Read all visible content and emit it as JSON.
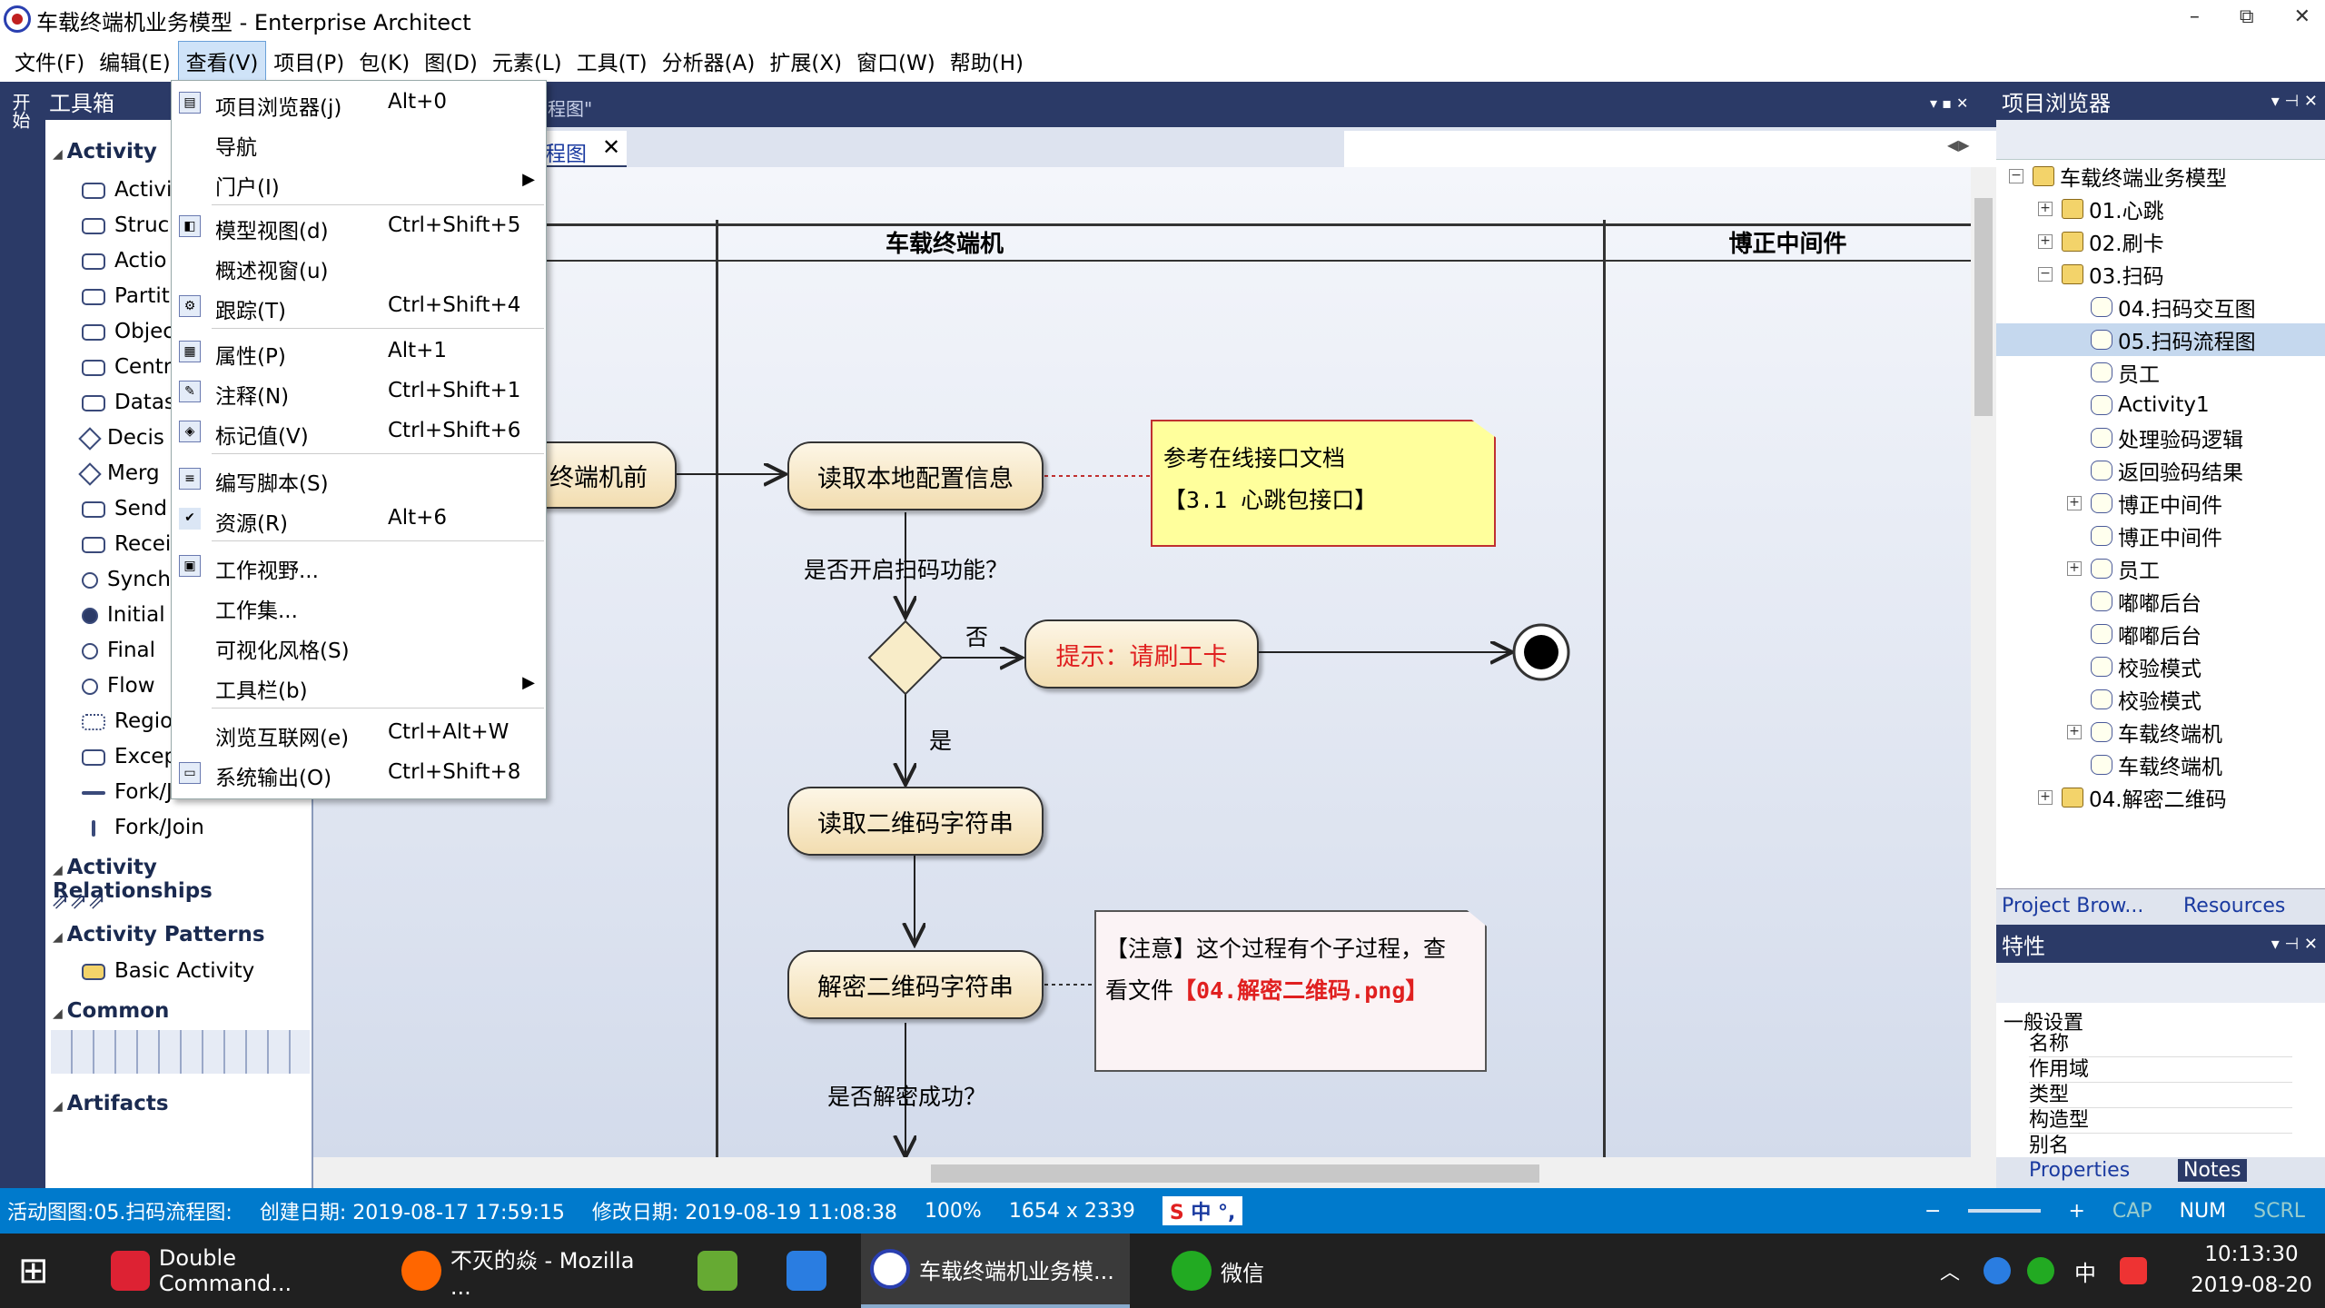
{
  "window": {
    "title": "车载终端机业务模型 - Enterprise Architect",
    "minimize": "–",
    "restore": "⧉",
    "close": "✕"
  },
  "menubar": [
    "文件(F)",
    "编辑(E)",
    "查看(V)",
    "项目(P)",
    "包(K)",
    "图(D)",
    "元素(L)",
    "工具(T)",
    "分析器(A)",
    "扩展(X)",
    "窗口(W)",
    "帮助(H)"
  ],
  "left_strip": {
    "label": "开始"
  },
  "toolbox": {
    "title": "工具箱",
    "sections": [
      "Activity",
      "Activity Relationships",
      "Activity Patterns",
      "Common",
      "Artifacts"
    ],
    "items": [
      "Activi",
      "Struc",
      "Actio",
      "Partit",
      "Objec",
      "Centr",
      "Datas",
      "Decis",
      "Merg",
      "Send",
      "Recei",
      "Synch",
      "Initial",
      "Final",
      "Flow",
      "Regio",
      "Excep",
      "Fork/Join",
      "Fork/Join"
    ],
    "pattern_item": "Basic Activity"
  },
  "view_menu": {
    "items": [
      {
        "label": "项目浏览器(j)",
        "shortcut": "Alt+0"
      },
      {
        "label": "导航",
        "shortcut": ""
      },
      {
        "label": "门户(I)",
        "shortcut": "",
        "submenu": "▶"
      },
      {
        "label": "模型视图(d)",
        "shortcut": "Ctrl+Shift+5"
      },
      {
        "label": "概述视窗(u)",
        "shortcut": ""
      },
      {
        "label": "跟踪(T)",
        "shortcut": "Ctrl+Shift+4"
      },
      {
        "label": "属性(P)",
        "shortcut": "Alt+1"
      },
      {
        "label": "注释(N)",
        "shortcut": "Ctrl+Shift+1"
      },
      {
        "label": "标记值(V)",
        "shortcut": "Ctrl+Shift+6"
      },
      {
        "label": "编写脚本(S)",
        "shortcut": ""
      },
      {
        "label": "资源(R)",
        "shortcut": "Alt+6"
      },
      {
        "label": "工作视野...",
        "shortcut": ""
      },
      {
        "label": "工作集...",
        "shortcut": ""
      },
      {
        "label": "可视化风格(S)",
        "shortcut": ""
      },
      {
        "label": "工具栏(b)",
        "shortcut": "",
        "submenu": "▶"
      },
      {
        "label": "浏览互联网(e)",
        "shortcut": "Ctrl+Alt+W"
      },
      {
        "label": "系统输出(O)",
        "shortcut": "Ctrl+Shift+8"
      }
    ]
  },
  "doc_tab": {
    "partial_label": "程图\"",
    "active_label": "程图",
    "close": "✕"
  },
  "diagram": {
    "lanes": [
      "车载终端机",
      "博正中间件"
    ],
    "nodes": {
      "n_before": "终端机前",
      "n_read_config": "读取本地配置信息",
      "n_hint": "提示：请刷工卡",
      "n_read_qr": "读取二维码字符串",
      "n_decrypt": "解密二维码字符串"
    },
    "labels": {
      "q_scan": "是否开启扫码功能？",
      "no": "否",
      "yes": "是",
      "q_decrypt": "是否解密成功？"
    },
    "note1": {
      "line1": "参考在线接口文档",
      "line2": "【3.1 心跳包接口】"
    },
    "note2": {
      "line1": "【注意】这个过程有个子过程，查",
      "line2_prefix": "看文件",
      "line2_red": "【04.解密二维码.png】"
    }
  },
  "project_browser": {
    "title": "项目浏览器",
    "tree": [
      {
        "label": "车载终端业务模型",
        "level": 0,
        "exp": "−"
      },
      {
        "label": "01.心跳",
        "level": 1,
        "exp": "+"
      },
      {
        "label": "02.刷卡",
        "level": 1,
        "exp": "+"
      },
      {
        "label": "03.扫码",
        "level": 1,
        "exp": "−"
      },
      {
        "label": "04.扫码交互图",
        "level": 2,
        "exp": ""
      },
      {
        "label": "05.扫码流程图",
        "level": 2,
        "exp": "",
        "selected": true
      },
      {
        "label": "员工",
        "level": 2,
        "exp": ""
      },
      {
        "label": "Activity1",
        "level": 2,
        "exp": ""
      },
      {
        "label": "处理验码逻辑",
        "level": 2,
        "exp": ""
      },
      {
        "label": "返回验码结果",
        "level": 2,
        "exp": ""
      },
      {
        "label": "博正中间件",
        "level": 2,
        "exp": "+"
      },
      {
        "label": "博正中间件",
        "level": 2,
        "exp": ""
      },
      {
        "label": "员工",
        "level": 2,
        "exp": "+"
      },
      {
        "label": "嘟嘟后台",
        "level": 2,
        "exp": ""
      },
      {
        "label": "嘟嘟后台",
        "level": 2,
        "exp": ""
      },
      {
        "label": "校验模式",
        "level": 2,
        "exp": ""
      },
      {
        "label": "校验模式",
        "level": 2,
        "exp": ""
      },
      {
        "label": "车载终端机",
        "level": 2,
        "exp": "+"
      },
      {
        "label": "车载终端机",
        "level": 2,
        "exp": ""
      },
      {
        "label": "04.解密二维码",
        "level": 1,
        "exp": "+"
      }
    ],
    "tabs": [
      "Project Brow...",
      "Resources"
    ]
  },
  "properties": {
    "title": "特性",
    "section": "一般设置",
    "rows": [
      "名称",
      "作用域",
      "类型",
      "构造型",
      "别名"
    ],
    "tabs": [
      "Properties",
      "Notes"
    ]
  },
  "statusbar": {
    "active": "活动图图:05.扫码流程图:",
    "created": "创建日期: 2019-08-17 17:59:15",
    "modified": "修改日期: 2019-08-19 11:08:38",
    "zoom": "100%",
    "size": "1654 x 2339",
    "ime": "中",
    "ime_punct": "°,",
    "minus": "−",
    "plus": "+",
    "caps": "CAP",
    "num": "NUM",
    "scrl": "SCRL"
  },
  "taskbar": {
    "items": [
      "Double Command...",
      "不灭的焱 - Mozilla ...",
      "车载终端机业务模...",
      "微信"
    ],
    "tray_ime": "中",
    "time": "10:13:30",
    "date": "2019-08-20"
  },
  "colors": {
    "accent": "#2b3a67",
    "status": "#007acc",
    "red_text": "#e02020"
  }
}
